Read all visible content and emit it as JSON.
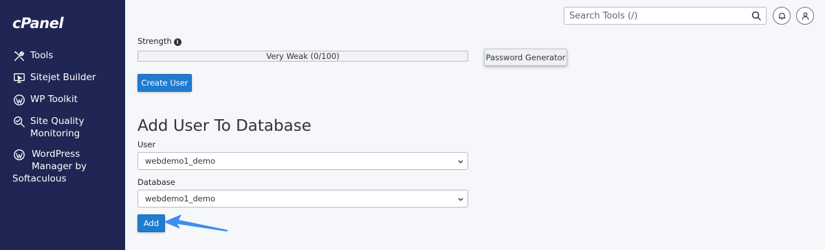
{
  "sidebar": {
    "logo": "cPanel",
    "items": [
      {
        "label": "Tools",
        "icon": "tools-icon"
      },
      {
        "label": "Sitejet Builder",
        "icon": "monitor-icon"
      },
      {
        "label": "WP Toolkit",
        "icon": "wordpress-icon"
      },
      {
        "label_line1": "Site Quality",
        "label_line2": "Monitoring",
        "icon": "magnify-check-icon"
      },
      {
        "label_line1": "WordPress",
        "label_line2": "Manager by",
        "label_line3": "Softaculous",
        "icon": "wordpress-icon"
      }
    ]
  },
  "header": {
    "search_placeholder": "Search Tools (/)"
  },
  "form": {
    "strength_label": "Strength",
    "strength_value": "Very Weak (0/100)",
    "password_generator_label": "Password Generator",
    "create_user_label": "Create User"
  },
  "add_user": {
    "heading": "Add User To Database",
    "user_label": "User",
    "user_value": "webdemo1_demo",
    "database_label": "Database",
    "database_value": "webdemo1_demo",
    "add_label": "Add"
  },
  "colors": {
    "sidebar_bg": "#1f2653",
    "primary_button": "#1f7bd0",
    "annotation_arrow": "#3d8ef0"
  }
}
